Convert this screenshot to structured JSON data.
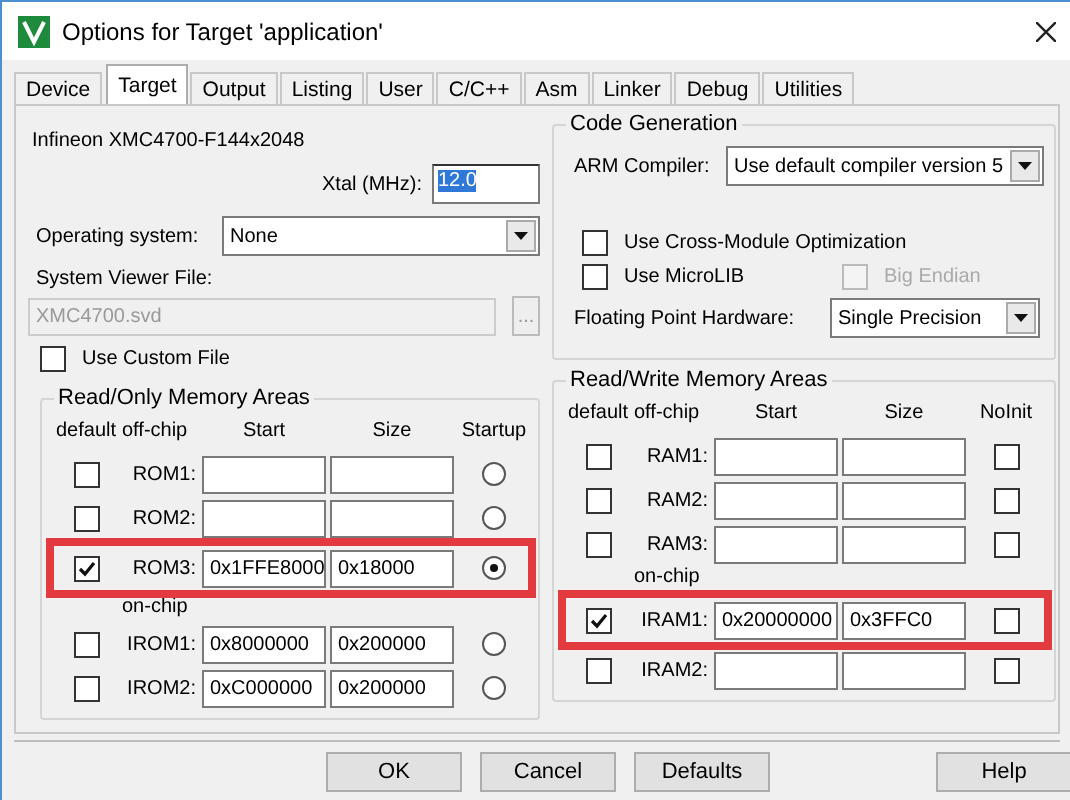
{
  "window": {
    "title": "Options for Target 'application'"
  },
  "tabs": [
    {
      "label": "Device",
      "selected": false
    },
    {
      "label": "Target",
      "selected": true
    },
    {
      "label": "Output",
      "selected": false
    },
    {
      "label": "Listing",
      "selected": false
    },
    {
      "label": "User",
      "selected": false
    },
    {
      "label": "C/C++",
      "selected": false
    },
    {
      "label": "Asm",
      "selected": false
    },
    {
      "label": "Linker",
      "selected": false
    },
    {
      "label": "Debug",
      "selected": false
    },
    {
      "label": "Utilities",
      "selected": false
    }
  ],
  "target": {
    "device": "Infineon XMC4700-F144x2048",
    "xtal": {
      "label": "Xtal (MHz):",
      "value": "12.0",
      "text_selected": true
    },
    "operating_system": {
      "label": "Operating system:",
      "value": "None"
    },
    "system_viewer_file": {
      "label": "System Viewer File:",
      "value": "XMC4700.svd",
      "disabled": true,
      "browse": "..."
    },
    "use_custom_file": {
      "label": "Use Custom File",
      "checked": false
    }
  },
  "code_generation": {
    "title": "Code Generation",
    "arm_compiler": {
      "label": "ARM Compiler:",
      "value": "Use default compiler version 5"
    },
    "options": [
      {
        "label": "Use Cross-Module Optimization",
        "checked": false,
        "disabled": false
      },
      {
        "label": "Use MicroLIB",
        "checked": false,
        "disabled": false
      },
      {
        "label": "Big Endian",
        "checked": false,
        "disabled": true
      }
    ],
    "floating_point": {
      "label": "Floating Point Hardware:",
      "value": "Single Precision"
    }
  },
  "rom_areas": {
    "title": "Read/Only Memory Areas",
    "columns": [
      "default",
      "off-chip",
      "Start",
      "Size",
      "Startup"
    ],
    "rows": [
      {
        "kind": "area",
        "label": "ROM1:",
        "default": false,
        "start": "",
        "size": "",
        "startup": false,
        "highlighted": false
      },
      {
        "kind": "area",
        "label": "ROM2:",
        "default": false,
        "start": "",
        "size": "",
        "startup": false,
        "highlighted": false
      },
      {
        "kind": "area",
        "label": "ROM3:",
        "default": true,
        "start": "0x1FFE8000",
        "size": "0x18000",
        "startup": true,
        "highlighted": true
      },
      {
        "kind": "section",
        "label": "on-chip"
      },
      {
        "kind": "area",
        "label": "IROM1:",
        "default": false,
        "start": "0x8000000",
        "size": "0x200000",
        "startup": false,
        "highlighted": false
      },
      {
        "kind": "area",
        "label": "IROM2:",
        "default": false,
        "start": "0xC000000",
        "size": "0x200000",
        "startup": false,
        "highlighted": false
      }
    ]
  },
  "ram_areas": {
    "title": "Read/Write Memory Areas",
    "columns": [
      "default",
      "off-chip",
      "Start",
      "Size",
      "NoInit"
    ],
    "rows": [
      {
        "kind": "area",
        "label": "RAM1:",
        "default": false,
        "start": "",
        "size": "",
        "noinit": false,
        "highlighted": false
      },
      {
        "kind": "area",
        "label": "RAM2:",
        "default": false,
        "start": "",
        "size": "",
        "noinit": false,
        "highlighted": false
      },
      {
        "kind": "area",
        "label": "RAM3:",
        "default": false,
        "start": "",
        "size": "",
        "noinit": false,
        "highlighted": false
      },
      {
        "kind": "section",
        "label": "on-chip"
      },
      {
        "kind": "area",
        "label": "IRAM1:",
        "default": true,
        "start": "0x20000000",
        "size": "0x3FFC0",
        "noinit": false,
        "highlighted": true
      },
      {
        "kind": "area",
        "label": "IRAM2:",
        "default": false,
        "start": "",
        "size": "",
        "noinit": false,
        "highlighted": false
      }
    ]
  },
  "buttons": [
    {
      "label": "OK"
    },
    {
      "label": "Cancel"
    },
    {
      "label": "Defaults"
    },
    {
      "label": "Help"
    }
  ]
}
